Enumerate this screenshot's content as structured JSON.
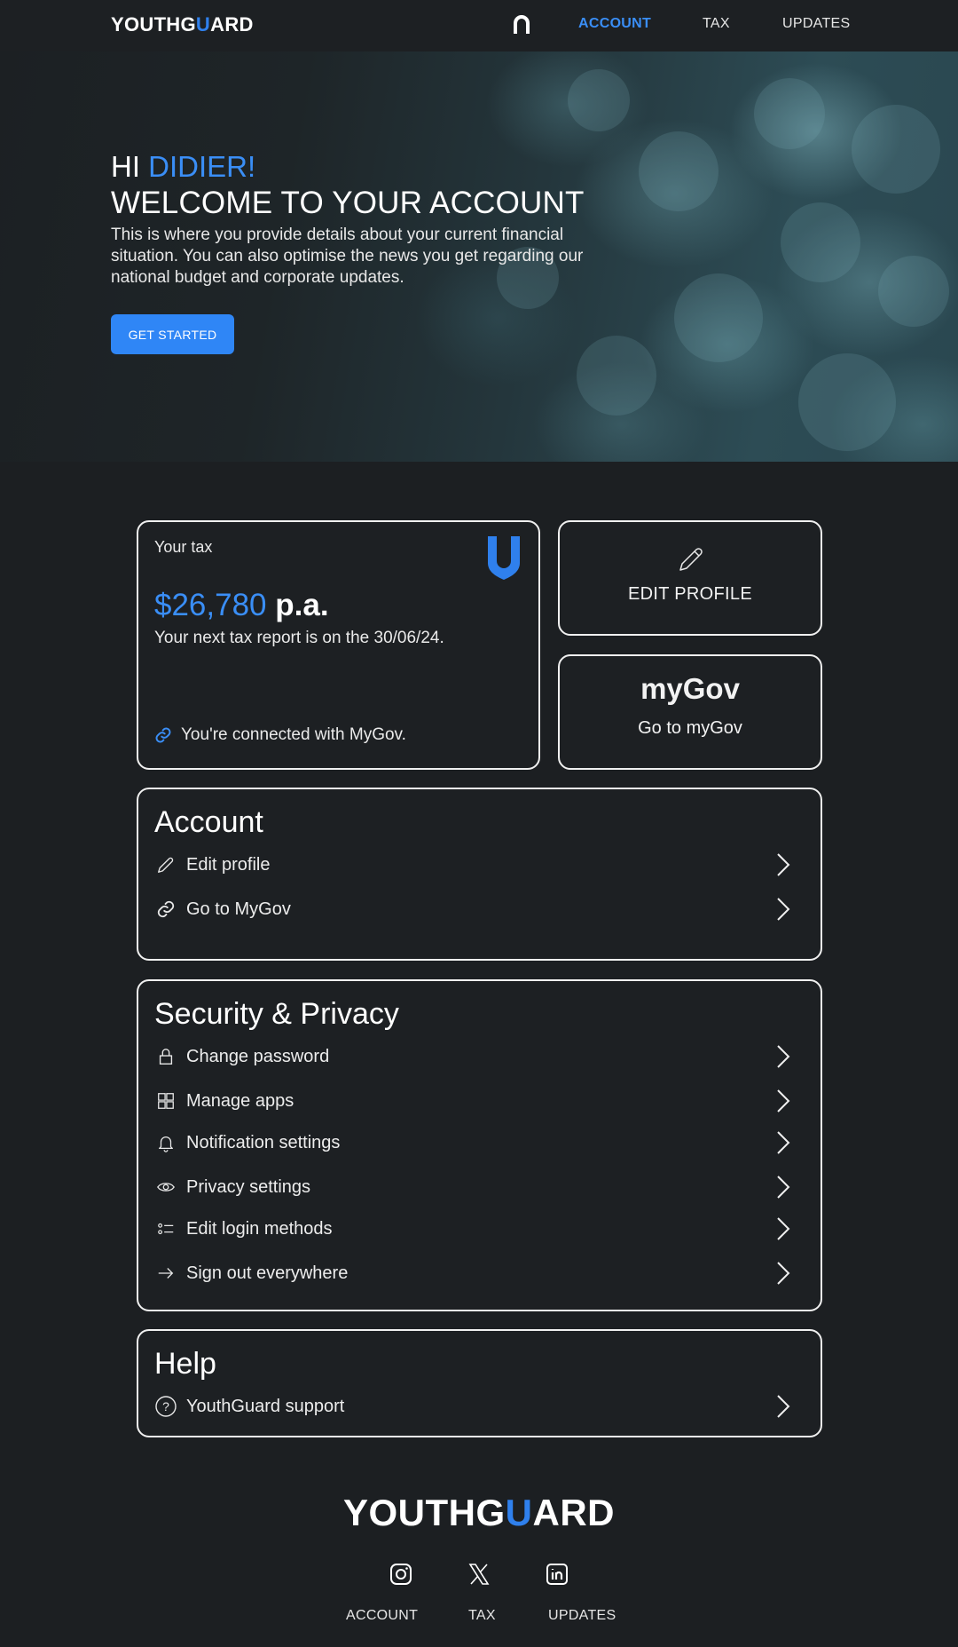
{
  "nav": {
    "logo_left": "YOUTHG",
    "logo_u": "U",
    "logo_right": "ARD",
    "home_icon": "arch-home-icon",
    "links": [
      "ACCOUNT",
      "TAX",
      "UPDATES"
    ],
    "active": "ACCOUNT",
    "accent": "#3a8ef6"
  },
  "hero": {
    "greet_prefix": "HI ",
    "name": "DIDIER!",
    "title": "WELCOME TO YOUR ACCOUNT",
    "description": "This is where you provide details about your current financial situation. You can also optimise the news you get regarding our national budget and corporate updates.",
    "button": "GET STARTED"
  },
  "tax_card": {
    "label": "Your tax",
    "amount": "$26,780",
    "unit": "p.a.",
    "next": "Your next tax report is on the 30/06/24.",
    "connected": "You're connected with MyGov."
  },
  "edit_card": {
    "label": "EDIT PROFILE",
    "icon": "pencil-icon"
  },
  "gov_card": {
    "logo": "myGov",
    "label": "Go to myGov"
  },
  "account": {
    "title": "Account",
    "items": [
      {
        "label": "Edit profile",
        "icon": "pencil-icon"
      },
      {
        "label": "Go to MyGov",
        "icon": "link-icon"
      }
    ]
  },
  "security": {
    "title": "Security & Privacy",
    "items": [
      {
        "label": "Change password",
        "icon": "lock-icon"
      },
      {
        "label": "Manage apps",
        "icon": "grid-icon"
      },
      {
        "label": "Notification settings",
        "icon": "bell-icon"
      },
      {
        "label": "Privacy settings",
        "icon": "eye-icon"
      },
      {
        "label": "Edit login methods",
        "icon": "list-icon"
      },
      {
        "label": "Sign out everywhere",
        "icon": "arrow-right-icon"
      }
    ]
  },
  "help": {
    "title": "Help",
    "items": [
      {
        "label": "YouthGuard support",
        "icon": "question-icon"
      }
    ]
  },
  "footer": {
    "logo_left": "YOUTHG",
    "logo_u": "U",
    "logo_right": "ARD",
    "social": [
      "instagram-icon",
      "x-icon",
      "linkedin-icon"
    ],
    "links": [
      "ACCOUNT",
      "TAX",
      "UPDATES"
    ]
  }
}
